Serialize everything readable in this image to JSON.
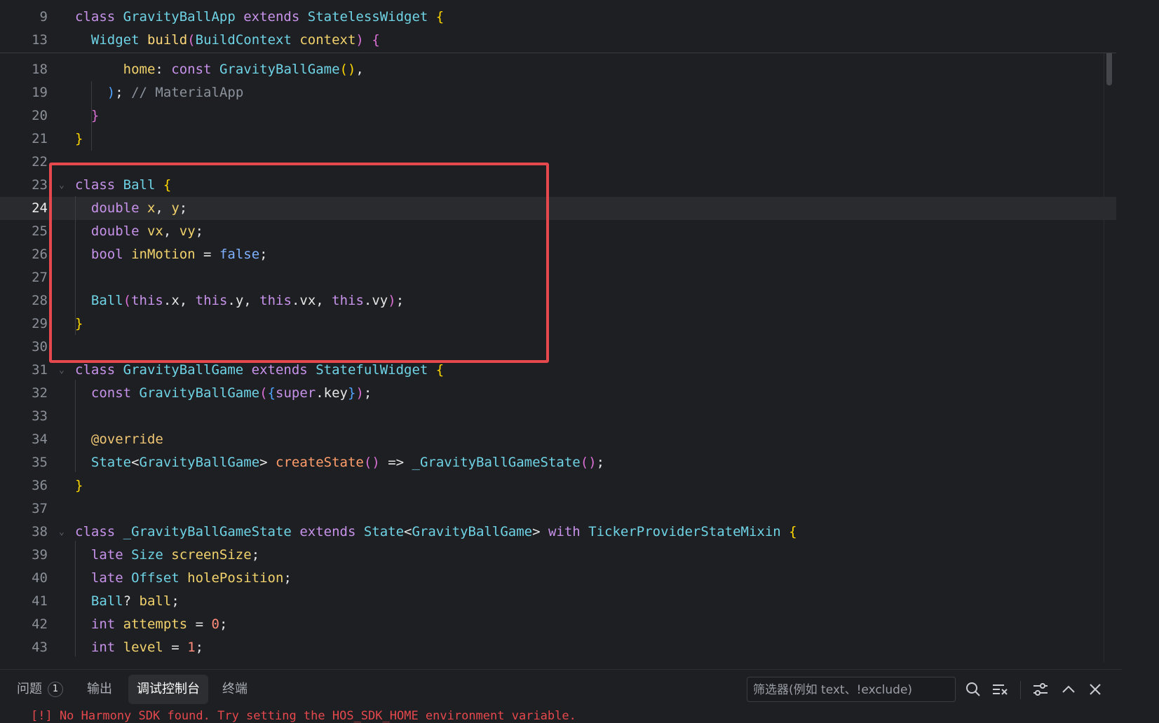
{
  "sticky_lines": [
    {
      "n": "9",
      "code": [
        [
          "kw",
          "class "
        ],
        [
          "ty",
          "GravityBallApp "
        ],
        [
          "kw",
          "extends "
        ],
        [
          "ty",
          "StatelessWidget "
        ],
        [
          "b1",
          "{"
        ]
      ]
    },
    {
      "n": "13",
      "code": [
        [
          "",
          "  "
        ],
        [
          "ty",
          "Widget "
        ],
        [
          "fn",
          "build"
        ],
        [
          "b2",
          "("
        ],
        [
          "ty",
          "BuildContext "
        ],
        [
          "nm",
          "context"
        ],
        [
          "b2",
          ")"
        ],
        [
          "",
          " "
        ],
        [
          "b2",
          "{"
        ]
      ]
    }
  ],
  "lines": [
    {
      "n": "18",
      "code": [
        [
          "",
          "      "
        ],
        [
          "nm",
          "home"
        ],
        [
          "",
          ": "
        ],
        [
          "kw",
          "const "
        ],
        [
          "ty",
          "GravityBallGame"
        ],
        [
          "b1",
          "()"
        ],
        [
          "",
          ","
        ]
      ]
    },
    {
      "n": "19",
      "code": [
        [
          "",
          "    "
        ],
        [
          "b3",
          ")"
        ],
        [
          "",
          ";"
        ],
        [
          "cm",
          " // MaterialApp"
        ]
      ]
    },
    {
      "n": "20",
      "code": [
        [
          "",
          "  "
        ],
        [
          "b2",
          "}"
        ]
      ]
    },
    {
      "n": "21",
      "code": [
        [
          "b1",
          "}"
        ]
      ]
    },
    {
      "n": "22",
      "code": []
    },
    {
      "n": "23",
      "code": [
        [
          "kw",
          "class "
        ],
        [
          "ty",
          "Ball "
        ],
        [
          "b1",
          "{"
        ]
      ],
      "fold": true
    },
    {
      "n": "24",
      "code": [
        [
          "",
          "  "
        ],
        [
          "kw",
          "double "
        ],
        [
          "nm",
          "x"
        ],
        [
          "",
          ", "
        ],
        [
          "nm",
          "y"
        ],
        [
          "",
          ";"
        ]
      ],
      "active": true
    },
    {
      "n": "25",
      "code": [
        [
          "",
          "  "
        ],
        [
          "kw",
          "double "
        ],
        [
          "nm",
          "vx"
        ],
        [
          "",
          ", "
        ],
        [
          "nm",
          "vy"
        ],
        [
          "",
          ";"
        ]
      ]
    },
    {
      "n": "26",
      "code": [
        [
          "",
          "  "
        ],
        [
          "kw",
          "bool "
        ],
        [
          "nm",
          "inMotion"
        ],
        [
          "",
          " = "
        ],
        [
          "kwb",
          "false"
        ],
        [
          "",
          ";"
        ]
      ]
    },
    {
      "n": "27",
      "code": []
    },
    {
      "n": "28",
      "code": [
        [
          "",
          "  "
        ],
        [
          "ty",
          "Ball"
        ],
        [
          "b2",
          "("
        ],
        [
          "kw",
          "this"
        ],
        [
          "",
          ".x, "
        ],
        [
          "kw",
          "this"
        ],
        [
          "",
          ".y, "
        ],
        [
          "kw",
          "this"
        ],
        [
          "",
          ".vx, "
        ],
        [
          "kw",
          "this"
        ],
        [
          "",
          ".vy"
        ],
        [
          "b2",
          ")"
        ],
        [
          "",
          ";"
        ]
      ]
    },
    {
      "n": "29",
      "code": [
        [
          "b1",
          "}"
        ]
      ]
    },
    {
      "n": "30",
      "code": []
    },
    {
      "n": "31",
      "code": [
        [
          "kw",
          "class "
        ],
        [
          "ty",
          "GravityBallGame "
        ],
        [
          "kw",
          "extends "
        ],
        [
          "ty",
          "StatefulWidget "
        ],
        [
          "b1",
          "{"
        ]
      ],
      "fold": true
    },
    {
      "n": "32",
      "code": [
        [
          "",
          "  "
        ],
        [
          "kw",
          "const "
        ],
        [
          "ty",
          "GravityBallGame"
        ],
        [
          "b2",
          "("
        ],
        [
          "b3",
          "{"
        ],
        [
          "kw",
          "super"
        ],
        [
          "",
          ".key"
        ],
        [
          "b3",
          "}"
        ],
        [
          "b2",
          ")"
        ],
        [
          "",
          ";"
        ]
      ]
    },
    {
      "n": "33",
      "code": []
    },
    {
      "n": "34",
      "code": [
        [
          "",
          "  "
        ],
        [
          "ann",
          "@override"
        ]
      ]
    },
    {
      "n": "35",
      "code": [
        [
          "",
          "  "
        ],
        [
          "ty",
          "State"
        ],
        [
          "",
          "<"
        ],
        [
          "ty",
          "GravityBallGame"
        ],
        [
          "",
          "> "
        ],
        [
          "call",
          "createState"
        ],
        [
          "b2",
          "()"
        ],
        [
          "",
          " => "
        ],
        [
          "ty",
          "_GravityBallGameState"
        ],
        [
          "b2",
          "()"
        ],
        [
          "",
          ";"
        ]
      ]
    },
    {
      "n": "36",
      "code": [
        [
          "b1",
          "}"
        ]
      ]
    },
    {
      "n": "37",
      "code": []
    },
    {
      "n": "38",
      "code": [
        [
          "kw",
          "class "
        ],
        [
          "ty",
          "_GravityBallGameState "
        ],
        [
          "kw",
          "extends "
        ],
        [
          "ty",
          "State"
        ],
        [
          "",
          "<"
        ],
        [
          "ty",
          "GravityBallGame"
        ],
        [
          "",
          "> "
        ],
        [
          "kw",
          "with "
        ],
        [
          "ty",
          "TickerProviderStateMixin "
        ],
        [
          "b1",
          "{"
        ]
      ],
      "fold": true
    },
    {
      "n": "39",
      "code": [
        [
          "",
          "  "
        ],
        [
          "kw",
          "late "
        ],
        [
          "ty",
          "Size "
        ],
        [
          "nm",
          "screenSize"
        ],
        [
          "",
          ";"
        ]
      ]
    },
    {
      "n": "40",
      "code": [
        [
          "",
          "  "
        ],
        [
          "kw",
          "late "
        ],
        [
          "ty",
          "Offset "
        ],
        [
          "nm",
          "holePosition"
        ],
        [
          "",
          ";"
        ]
      ]
    },
    {
      "n": "41",
      "code": [
        [
          "",
          "  "
        ],
        [
          "ty",
          "Ball"
        ],
        [
          "",
          "? "
        ],
        [
          "nm",
          "ball"
        ],
        [
          "",
          ";"
        ]
      ]
    },
    {
      "n": "42",
      "code": [
        [
          "",
          "  "
        ],
        [
          "kw",
          "int "
        ],
        [
          "nm",
          "attempts"
        ],
        [
          "",
          " = "
        ],
        [
          "num",
          "0"
        ],
        [
          "",
          ";"
        ]
      ]
    },
    {
      "n": "43",
      "code": [
        [
          "",
          "  "
        ],
        [
          "kw",
          "int "
        ],
        [
          "nm",
          "level"
        ],
        [
          "",
          " = "
        ],
        [
          "num",
          "1"
        ],
        [
          "",
          ";"
        ]
      ]
    }
  ],
  "panel": {
    "tabs": {
      "problems": "问题",
      "problems_count": "1",
      "output": "输出",
      "debug_console": "调试控制台",
      "terminal": "终端"
    },
    "filter_placeholder": "筛选器(例如 text、!exclude)",
    "debug_line": "[!] No Harmony SDK found. Try setting the HOS_SDK_HOME environment variable."
  }
}
